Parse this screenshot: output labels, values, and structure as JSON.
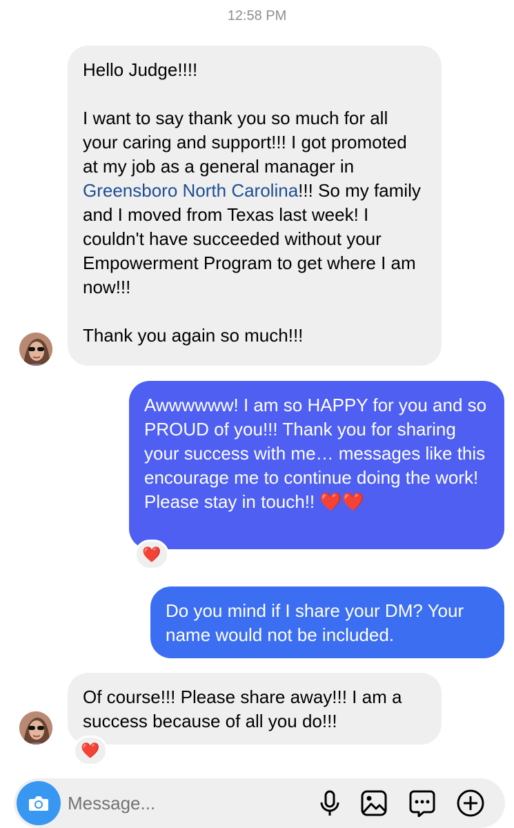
{
  "timestamp": "12:58 PM",
  "messages": [
    {
      "sender": "them",
      "p1": "Hello Judge!!!!",
      "p2a": "I want to say thank you so much for all your caring and support!!! I got promoted at my job as a general manager in ",
      "p2link": "Greensboro North Carolina",
      "p2b": "!!! So my family and I moved from Texas last week! I couldn't have succeeded without your Empowerment Program to get where I am now!!!",
      "p3": "Thank you again so much!!!"
    },
    {
      "sender": "me",
      "text": "Awwwwww! I am so HAPPY for you and so PROUD of you!!! Thank you for sharing your success with me… messages like this encourage me to continue doing the work! Please stay in touch!! ❤️❤️",
      "reaction": "❤️"
    },
    {
      "sender": "me",
      "text": "Do you mind if I share your DM? Your name would not be included."
    },
    {
      "sender": "them",
      "text": "Of course!!! Please share away!!! I am a success because of all you do!!!",
      "reaction": "❤️"
    }
  ],
  "composer": {
    "placeholder": "Message...",
    "icons": [
      "camera-icon",
      "microphone-icon",
      "image-icon",
      "sticker-icon",
      "plus-icon"
    ]
  },
  "colors": {
    "incoming_bubble": "#efefef",
    "outgoing_bubble_1": "#4e5ff2",
    "outgoing_bubble_2": "#3b6ef1",
    "link": "#1d4f91",
    "camera_button": "#3897f0"
  }
}
